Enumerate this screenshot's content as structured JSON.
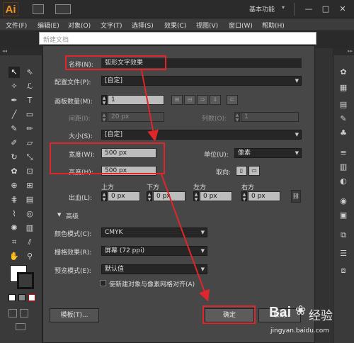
{
  "app": {
    "logo": "Ai",
    "workspace": "基本功能",
    "window_controls": [
      "—",
      "□",
      "✕"
    ]
  },
  "menus": [
    "文件(F)",
    "编辑(E)",
    "对象(O)",
    "文字(T)",
    "选择(S)",
    "效果(C)",
    "视图(V)",
    "窗口(W)",
    "帮助(H)"
  ],
  "tabstrip": {
    "placeholder": "新建文档"
  },
  "dialog": {
    "name_label": "名称(N):",
    "name_value": "弧形文字效果",
    "profile_label": "配置文件(P):",
    "profile_value": "[自定]",
    "artboards_label": "画板数量(M):",
    "artboards_value": "1",
    "spacing_label": "间距(I):",
    "spacing_value": "20 px",
    "columns_label": "列数(O):",
    "columns_value": "1",
    "size_label": "大小(S):",
    "size_value": "[自定]",
    "width_label": "宽度(W):",
    "width_value": "500 px",
    "units_label": "单位(U):",
    "units_value": "像素",
    "height_label": "高度(H):",
    "height_value": "500 px",
    "orientation_label": "取向:",
    "bleed_label": "出血(L):",
    "bleed": [
      {
        "title": "上方",
        "value": "0 px"
      },
      {
        "title": "下方",
        "value": "0 px"
      },
      {
        "title": "左方",
        "value": "0 px"
      },
      {
        "title": "右方",
        "value": "0 px"
      }
    ],
    "advanced_label": "高级",
    "color_mode_label": "颜色模式(C):",
    "color_mode_value": "CMYK",
    "raster_label": "栅格效果(R):",
    "raster_value": "屏幕 (72 ppi)",
    "preview_label": "预览模式(E):",
    "preview_value": "默认值",
    "align_label": "使新建对象与像素网格对齐(A)",
    "templates_button": "模板(T)...",
    "ok_button": "确定",
    "cancel_button": "取消"
  },
  "watermark": {
    "brand": "Bai",
    "brand2": "经验",
    "url": "jingyan.baidu.com"
  },
  "colors": {
    "highlight": "#e0252b",
    "accent": "#f7931e"
  }
}
